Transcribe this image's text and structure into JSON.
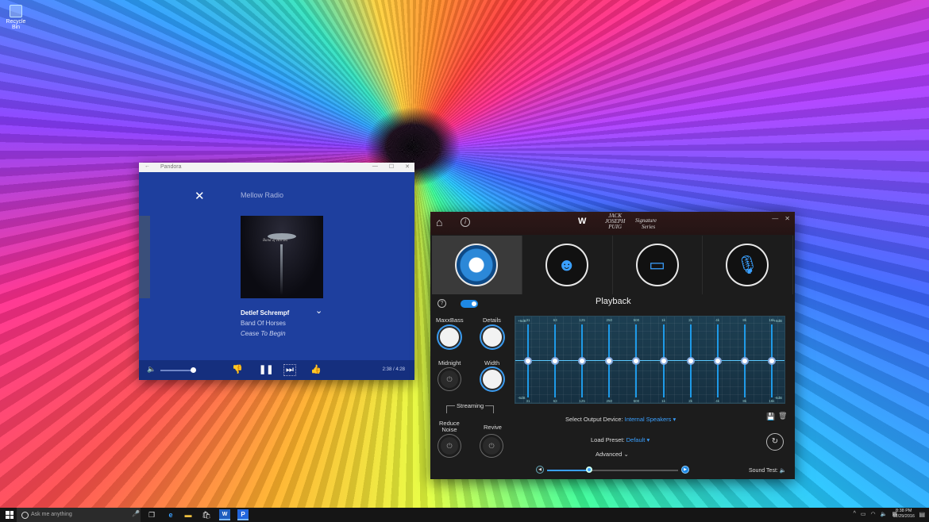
{
  "desktop": {
    "recycle_bin_label": "Recycle Bin"
  },
  "pandora": {
    "window_title": "Pandora",
    "station": "Mellow Radio",
    "song_title": "Detlef Schrempf",
    "artist": "Band Of Horses",
    "album": "Cease To Begin",
    "album_art_text": "Band of Horses",
    "time": "2:38 / 4:28",
    "volume_level": 0.85
  },
  "maxx": {
    "brand": "W",
    "jjp_text": [
      "JACK",
      "JOSEPH",
      "PUIG"
    ],
    "signature_line1": "Signature",
    "signature_line2": "Series",
    "modes": [
      {
        "name": "Speaker",
        "icon": "speaker-icon",
        "selected": true
      },
      {
        "name": "Headphones",
        "icon": "head-icon",
        "selected": false
      },
      {
        "name": "Laptop",
        "icon": "laptop-icon",
        "selected": false
      },
      {
        "name": "Microphone",
        "icon": "microphone-icon",
        "selected": false
      }
    ],
    "mode_title": "Playback",
    "knobs": {
      "maxxbass": "MaxxBass",
      "details": "Details",
      "midnight": "Midnight",
      "width": "Width",
      "streaming": "Streaming",
      "reduce_noise_1": "Reduce",
      "reduce_noise_2": "Noise",
      "revive": "Revive"
    },
    "eq": {
      "bands": [
        "31",
        "63",
        "125",
        "250",
        "500",
        "1k",
        "2k",
        "4k",
        "8k",
        "16k"
      ],
      "top_db": "+6dB",
      "bottom_db": "-6dB",
      "gains_db": [
        0,
        0,
        0,
        0,
        0,
        0,
        0,
        0,
        0,
        0
      ]
    },
    "output_label": "Select Output Device:",
    "output_value": "Internal Speakers",
    "preset_label": "Load Preset:",
    "preset_value": "Default",
    "advanced": "Advanced",
    "sound_test": "Sound Test:",
    "master_volume": 0.32
  },
  "taskbar": {
    "search_placeholder": "Ask me anything",
    "time": "8:38 PM",
    "date": "12/29/2016"
  }
}
